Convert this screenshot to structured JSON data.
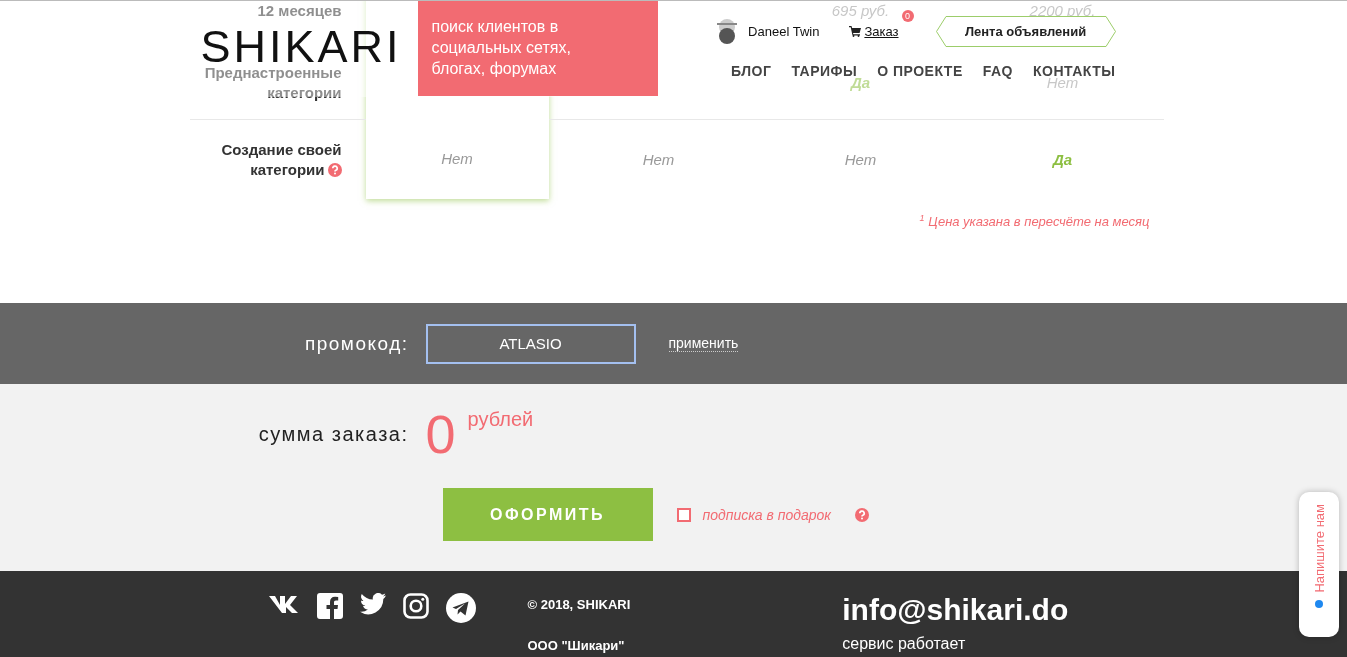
{
  "header": {
    "logo": "SHIKARI",
    "tagline": "поиск клиентов в социальных сетях, блогах, форумах",
    "user": {
      "name": "Daneel Twin"
    },
    "cart": {
      "label": "Заказ",
      "badge": "0"
    },
    "feed_button": "Лента объявлений",
    "nav": [
      "БЛОГ",
      "ТАРИФЫ",
      "О ПРОЕКТЕ",
      "FAQ",
      "КОНТАКТЫ"
    ]
  },
  "comparison_table": {
    "rows": [
      {
        "label": "12 месяцев",
        "cells": [
          null,
          null,
          {
            "text": "695 руб.",
            "kind": "price"
          },
          {
            "text": "2200 руб.",
            "kind": "price"
          }
        ]
      },
      {
        "label": "Преднастроенные категории",
        "cells": [
          null,
          null,
          {
            "text": "Да",
            "kind": "yes"
          },
          {
            "text": "Нет",
            "kind": "no"
          }
        ]
      },
      {
        "label": "Создание своей категории",
        "help": true,
        "cells": [
          {
            "text": "Нет",
            "kind": "no"
          },
          {
            "text": "Нет",
            "kind": "no"
          },
          {
            "text": "Нет",
            "kind": "no"
          },
          {
            "text": "Да",
            "kind": "yes"
          }
        ]
      }
    ],
    "footnote": "$^{1}$ Цена указана в пересчёте на месяц"
  },
  "promo": {
    "label": "промокод:",
    "value": "ATLASIO",
    "apply": "применить"
  },
  "order": {
    "label": "сумма заказа:",
    "amount": "0",
    "currency": "рублей",
    "submit": "ОФОРМИТЬ",
    "gift": {
      "label": "подписка в подарок",
      "checked": false
    }
  },
  "footer": {
    "copyright": "© 2018, SHIKARI",
    "company": "ООО \"Шикари\"",
    "email": "info@shikari.do",
    "hours": "сервис работает"
  },
  "chat_tab": {
    "label": "Напишите нам"
  }
}
